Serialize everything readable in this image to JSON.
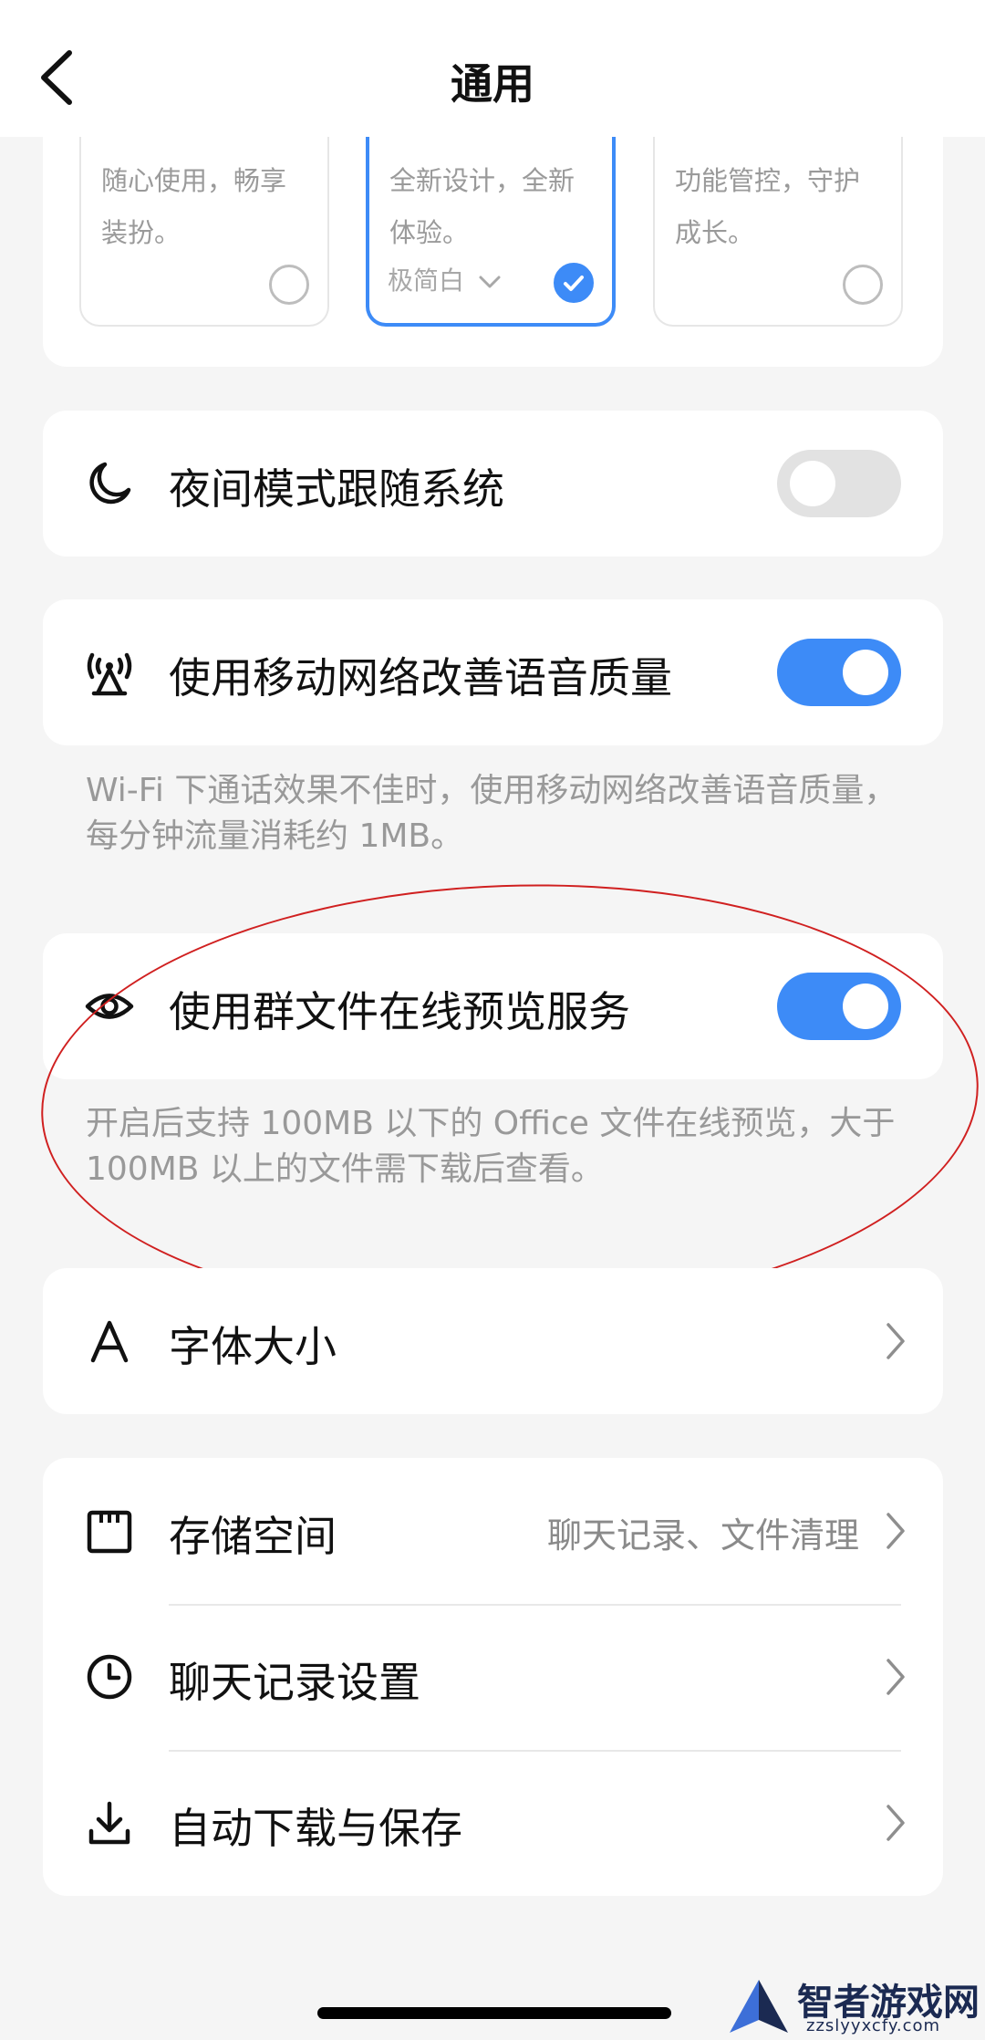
{
  "header": {
    "title": "通用"
  },
  "themes": [
    {
      "desc": "随心使用，畅享装扮。",
      "selected": false
    },
    {
      "desc": "全新设计，全新体验。",
      "sub": "极简白",
      "selected": true
    },
    {
      "desc": "功能管控，守护成长。",
      "selected": false
    }
  ],
  "night_mode": {
    "label": "夜间模式跟随系统",
    "enabled": false
  },
  "mobile_voice": {
    "label": "使用移动网络改善语音质量",
    "enabled": true,
    "hint": "Wi-Fi 下通话效果不佳时，使用移动网络改善语音质量，每分钟流量消耗约 1MB。"
  },
  "group_preview": {
    "label": "使用群文件在线预览服务",
    "enabled": true,
    "hint": "开启后支持 100MB 以下的 Office 文件在线预览，大于 100MB 以上的文件需下载后查看。"
  },
  "font_size": {
    "label": "字体大小"
  },
  "storage": {
    "label": "存储空间",
    "value": "聊天记录、文件清理"
  },
  "chat_history": {
    "label": "聊天记录设置"
  },
  "auto_download": {
    "label": "自动下载与保存"
  },
  "watermark": {
    "text": "智者游戏网",
    "url": "zzslyyxcfy.com"
  },
  "colors": {
    "accent": "#3d8bf7",
    "annotation": "#d02020"
  }
}
